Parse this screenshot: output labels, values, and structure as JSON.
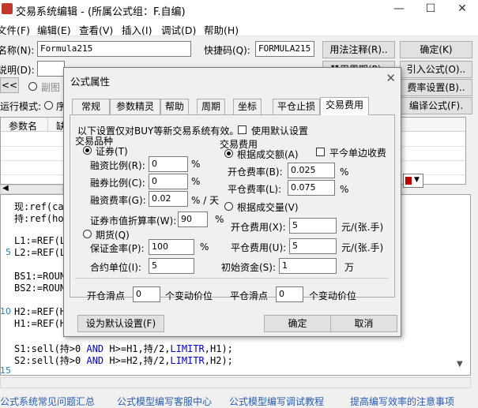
{
  "window": {
    "title": "交易系统编辑 - (所属公式组：F.自编)",
    "controls": [
      "—",
      "☐",
      "✕"
    ]
  },
  "menu": [
    "文件(F)",
    "编辑(E)",
    "查看(V)",
    "插入(I)",
    "调试(D)",
    "帮助(H)"
  ],
  "form": {
    "name_label": "名称(N):",
    "name_value": "Formula215",
    "shortcut_label": "快捷码(Q):",
    "shortcut_value": "FORMULA215",
    "desc_label": "说明(D):",
    "back_btn": "<<",
    "radio_fragment": "副图",
    "mode_label": "运行模式:",
    "mode_radio": "序"
  },
  "right_buttons": [
    "用法注释(R)..",
    "确定(K)",
    "禁用周期(P)..",
    "引入公式(O)..",
    "费率设置(B)..",
    "编译公式(F)."
  ],
  "param_table": {
    "headers": [
      "参数名",
      "缺"
    ]
  },
  "editor": {
    "lines": [
      "现:ref(ca",
      "持:ref(ho",
      "",
      "L1:=REF(L",
      "L2:=REF(L",
      "",
      "BS1:=ROUN",
      "BS2:=ROUN",
      "",
      "H2:=REF(H",
      "H1:=REF(H",
      "",
      "S1:sell(持>0 AND H>=H1,持/2,LIMITR,H1);",
      "S2:sell(持>0 AND H>=H2,持/2,LIMITR,H2);",
      ""
    ],
    "line_numbers": {
      "n5": "5",
      "n10": "10",
      "n15": "15"
    }
  },
  "footer_links": [
    "公式系统常见问题汇总",
    "公式模型编写客服中心",
    "公式模型编写调试教程",
    "提高编写效率的注意事项"
  ],
  "dialog": {
    "title": "公式属性",
    "close": "✕",
    "tabs": [
      "常规",
      "参数精灵",
      "帮助",
      "周期",
      "坐标",
      "平仓止损",
      "交易费用"
    ],
    "active_tab": "交易费用",
    "notice": "以下设置仅对BUY等新交易系统有效。",
    "use_default": "使用默认设置",
    "product_group": "交易品种",
    "securities": "证券(T)",
    "margin_buy_ratio": {
      "label": "融资比例(R):",
      "value": "0",
      "unit": "%"
    },
    "short_ratio": {
      "label": "融券比例(C):",
      "value": "0",
      "unit": "%"
    },
    "financing_rate": {
      "label": "融资费率(G):",
      "value": "0.02",
      "unit": "% / 天"
    },
    "market_discount": {
      "label": "证券市值折算率(W):",
      "value": "90",
      "unit": "%"
    },
    "futures": "期货(Q)",
    "margin_rate": {
      "label": "保证金率(P):",
      "value": "100",
      "unit": "%"
    },
    "contract_unit": {
      "label": "合约单位(I):",
      "value": "5"
    },
    "fee_group": "交易费用",
    "by_amount": "根据成交额(A)",
    "close_one_side": "平今单边收费",
    "open_rate": {
      "label": "开仓费率(B):",
      "value": "0.025",
      "unit": "%"
    },
    "close_rate": {
      "label": "平仓费率(L):",
      "value": "0.075",
      "unit": "%"
    },
    "by_volume": "根据成交量(V)",
    "open_fee": {
      "label": "开仓费用(X):",
      "value": "5",
      "unit": "元/(张.手)"
    },
    "close_fee": {
      "label": "平仓费用(U):",
      "value": "5",
      "unit": "元/(张.手)"
    },
    "initial_capital": {
      "label": "初始资金(S):",
      "value": "1",
      "unit": "万"
    },
    "open_slip": {
      "label": "开仓滑点",
      "value": "0",
      "unit": "个变动价位"
    },
    "close_slip": {
      "label": "平仓滑点",
      "value": "0",
      "unit": "个变动价位"
    },
    "set_default_btn": "设为默认设置(F)",
    "ok_btn": "确定",
    "cancel_btn": "取消"
  }
}
